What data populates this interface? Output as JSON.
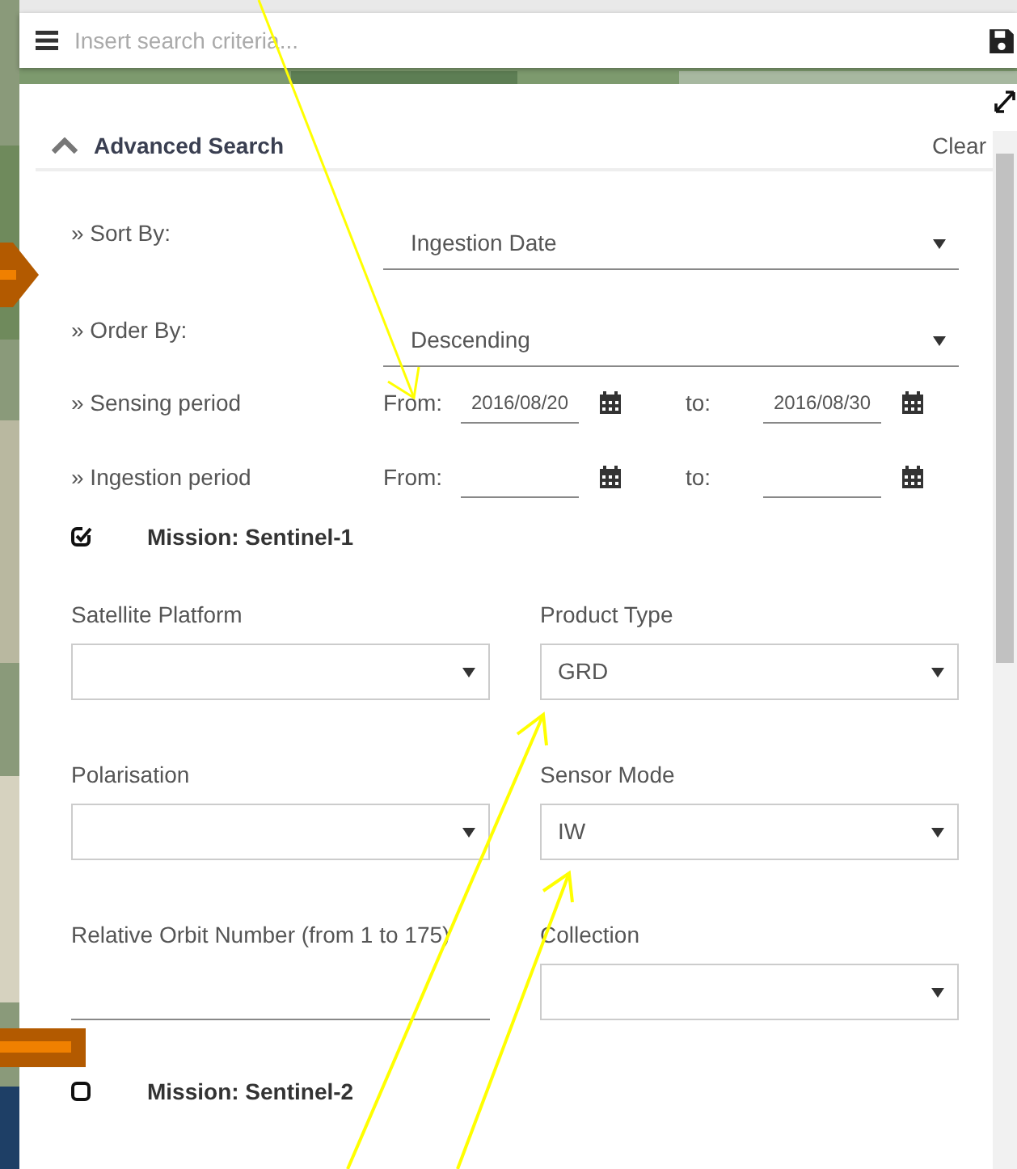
{
  "search": {
    "placeholder": "Insert search criteria..."
  },
  "advanced_search": {
    "title": "Advanced Search",
    "expanded": true,
    "clear": "Clear"
  },
  "sort_rows": [
    {
      "label": "» Sort By:",
      "value": "Ingestion Date"
    },
    {
      "label": "» Order By:",
      "value": "Descending"
    }
  ],
  "period_rows": [
    {
      "label": "» Sensing period",
      "from_label": "From:",
      "from": "2016/08/20",
      "to_label": "to:",
      "to": "2016/08/30"
    },
    {
      "label": "» Ingestion period",
      "from_label": "From:",
      "to_label": "to:"
    }
  ],
  "missions": [
    {
      "name": "Mission: Sentinel-1",
      "checked": true,
      "fields": [
        {
          "kind": "select",
          "label": "Satellite Platform"
        },
        {
          "kind": "select",
          "label": "Product Type",
          "value": "GRD"
        },
        {
          "kind": "select",
          "label": "Polarisation"
        },
        {
          "kind": "select",
          "label": "Sensor Mode",
          "value": "IW"
        },
        {
          "kind": "text",
          "label": "Relative Orbit Number (from 1 to 175)"
        },
        {
          "kind": "select",
          "label": "Collection"
        }
      ]
    },
    {
      "name": "Mission: Sentinel-2",
      "checked": false
    }
  ]
}
